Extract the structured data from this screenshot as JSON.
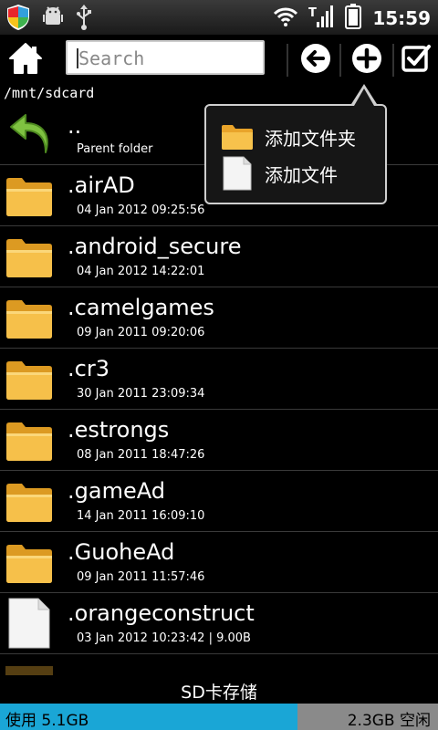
{
  "status_bar": {
    "time": "15:59"
  },
  "toolbar": {
    "search_placeholder": "Search"
  },
  "path": "/mnt/sdcard",
  "list": {
    "parent": {
      "name": "..",
      "meta": "Parent folder"
    },
    "items": [
      {
        "name": ".airAD",
        "meta": "04 Jan 2012 09:25:56",
        "type": "folder"
      },
      {
        "name": ".android_secure",
        "meta": "04 Jan 2012 14:22:01",
        "type": "folder"
      },
      {
        "name": ".camelgames",
        "meta": "09 Jan 2011 09:20:06",
        "type": "folder"
      },
      {
        "name": ".cr3",
        "meta": "30 Jan 2011 23:09:34",
        "type": "folder"
      },
      {
        "name": ".estrongs",
        "meta": "08 Jan 2011 18:47:26",
        "type": "folder"
      },
      {
        "name": ".gameAd",
        "meta": "14 Jan 2011 16:09:10",
        "type": "folder"
      },
      {
        "name": ".GuoheAd",
        "meta": "09 Jan 2011 11:57:46",
        "type": "folder"
      },
      {
        "name": ".orangeconstruct",
        "meta": "03 Jan 2012 10:23:42 | 9.00B",
        "type": "file"
      }
    ]
  },
  "popup": {
    "add_folder": "添加文件夹",
    "add_file": "添加文件"
  },
  "bottom": {
    "label": "SD卡存储",
    "used": "使用 5.1GB",
    "free": "2.3GB 空闲",
    "used_fraction": 0.68
  },
  "colors": {
    "storage_used": "#1aa6d6",
    "storage_free": "#8a8a8a",
    "folder": "#f2b335"
  }
}
